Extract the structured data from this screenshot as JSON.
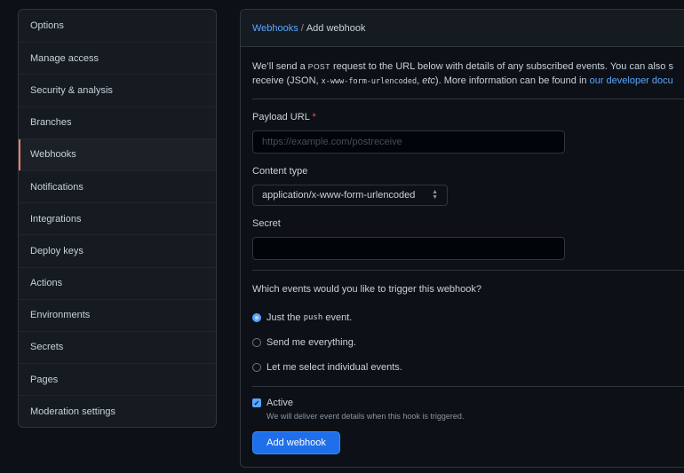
{
  "sidebar": {
    "items": [
      {
        "label": "Options"
      },
      {
        "label": "Manage access"
      },
      {
        "label": "Security & analysis"
      },
      {
        "label": "Branches"
      },
      {
        "label": "Webhooks"
      },
      {
        "label": "Notifications"
      },
      {
        "label": "Integrations"
      },
      {
        "label": "Deploy keys"
      },
      {
        "label": "Actions"
      },
      {
        "label": "Environments"
      },
      {
        "label": "Secrets"
      },
      {
        "label": "Pages"
      },
      {
        "label": "Moderation settings"
      }
    ],
    "active_index": 4
  },
  "breadcrumb": {
    "parent": "Webhooks",
    "separator": "/",
    "current": "Add webhook"
  },
  "intro": {
    "line1_a": "We’ll send a",
    "line1_post": "POST",
    "line1_b": "request to the URL below with details of any subscribed events. You can also s",
    "line2_a": "receive (JSON,",
    "line2_code": "x-www-form-urlencoded",
    "line2_b": ",",
    "line2_etc": "etc",
    "line2_c": "). More information can be found in",
    "line2_link": "our developer docu"
  },
  "form": {
    "payload_url": {
      "label": "Payload URL",
      "required_mark": "*",
      "placeholder": "https://example.com/postreceive",
      "value": ""
    },
    "content_type": {
      "label": "Content type",
      "selected": "application/x-www-form-urlencoded"
    },
    "secret": {
      "label": "Secret",
      "value": ""
    },
    "events_question": "Which events would you like to trigger this webhook?",
    "events": {
      "option1_a": "Just the",
      "option1_code": "push",
      "option1_b": "event.",
      "option2": "Send me everything.",
      "option3": "Let me select individual events."
    },
    "active": {
      "label": "Active",
      "description": "We will deliver event details when this hook is triggered.",
      "checked": true
    },
    "submit_label": "Add webhook"
  },
  "colors": {
    "accent": "#58a6ff",
    "active_marker": "#f78166",
    "button": "#1f6feb",
    "required": "#f85149"
  }
}
